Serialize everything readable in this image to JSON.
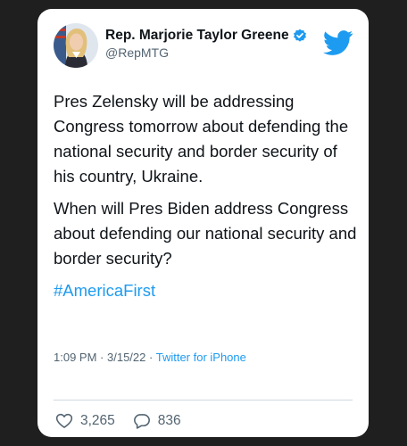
{
  "tweet": {
    "author_name": "Rep. Marjorie Taylor Greene",
    "author_handle": "@RepMTG",
    "paragraphs": [
      "Pres Zelensky will be addressing Congress tomorrow about defending the national security and border security of his country, Ukraine.",
      "When will Pres Biden address Congress about defending our national security and border security?"
    ],
    "hashtag": "#AmericaFirst",
    "time": "1:09 PM",
    "date": "3/15/22",
    "source": "Twitter for iPhone",
    "likes": "3,265",
    "replies": "836"
  },
  "icons": {
    "verified": "verified-badge-icon",
    "brand": "twitter-bird-icon",
    "like": "heart-icon",
    "reply": "reply-bubble-icon"
  },
  "colors": {
    "accent": "#1d9bf0",
    "text": "#0f1419",
    "muted": "#536471",
    "background": "#1f1f1f"
  }
}
